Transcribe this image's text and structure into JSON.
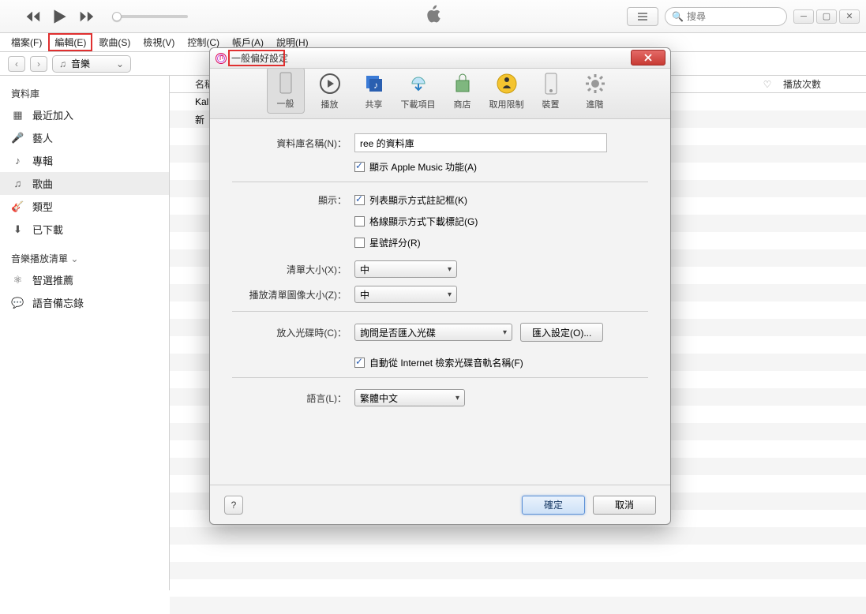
{
  "topbar": {
    "search_placeholder": "搜尋"
  },
  "menus": [
    "檔案(F)",
    "編輯(E)",
    "歌曲(S)",
    "檢視(V)",
    "控制(C)",
    "帳戶(A)",
    "說明(H)"
  ],
  "menu_highlight_index": 1,
  "nav_pill_label": "音樂",
  "sidebar": {
    "heading_library": "資料庫",
    "library_items": [
      {
        "icon": "recent",
        "label": "最近加入"
      },
      {
        "icon": "artist",
        "label": "藝人"
      },
      {
        "icon": "album",
        "label": "專輯"
      },
      {
        "icon": "song",
        "label": "歌曲"
      },
      {
        "icon": "genre",
        "label": "類型"
      },
      {
        "icon": "download",
        "label": "已下載"
      }
    ],
    "selected_index": 3,
    "heading_playlist": "音樂播放清單",
    "playlist_items": [
      {
        "icon": "genius",
        "label": "智選推薦"
      },
      {
        "icon": "memo",
        "label": "語音備忘錄"
      }
    ]
  },
  "columns": {
    "name": "名稱",
    "plays": "播放次數"
  },
  "rows": [
    "Kal",
    "新"
  ],
  "dialog": {
    "title": "一般偏好設定",
    "tabs": [
      "一般",
      "播放",
      "共享",
      "下載項目",
      "商店",
      "取用限制",
      "裝置",
      "進階"
    ],
    "selected_tab_index": 0,
    "library_name_label": "資料庫名稱(N)：",
    "library_name_value": "ree 的資料庫",
    "show_apple_music": "顯示 Apple Music 功能(A)",
    "display_label": "顯示：",
    "chk_list_checkbox": "列表顯示方式註記框(K)",
    "chk_grid_download": "格線顯示方式下載標記(G)",
    "chk_star_rating": "星號評分(R)",
    "list_size_label": "清單大小(X)：",
    "list_size_value": "中",
    "playlist_image_label": "播放清單圖像大小(Z)：",
    "playlist_image_value": "中",
    "cd_insert_label": "放入光碟時(C)：",
    "cd_insert_value": "詢問是否匯入光碟",
    "import_settings_btn": "匯入設定(O)...",
    "auto_cddb": "自動從 Internet 檢索光碟音軌名稱(F)",
    "language_label": "語言(L)：",
    "language_value": "繁體中文",
    "help": "?",
    "ok": "確定",
    "cancel": "取消"
  }
}
